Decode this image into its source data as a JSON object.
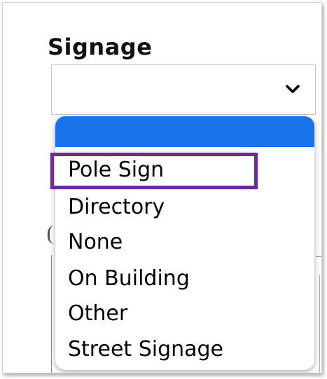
{
  "field": {
    "label": "Signage",
    "selected_value": ""
  },
  "icons": {
    "dropdown": "chevron-down-icon"
  },
  "colors": {
    "highlighted_option": "#1a73e8",
    "annotation_box": "#6b2f8f"
  },
  "dropdown": {
    "options": [
      {
        "label": "",
        "state": "highlighted"
      },
      {
        "label": "Pole Sign"
      },
      {
        "label": "Directory"
      },
      {
        "label": "None"
      },
      {
        "label": "On Building"
      },
      {
        "label": "Other"
      },
      {
        "label": "Street Signage"
      }
    ]
  }
}
